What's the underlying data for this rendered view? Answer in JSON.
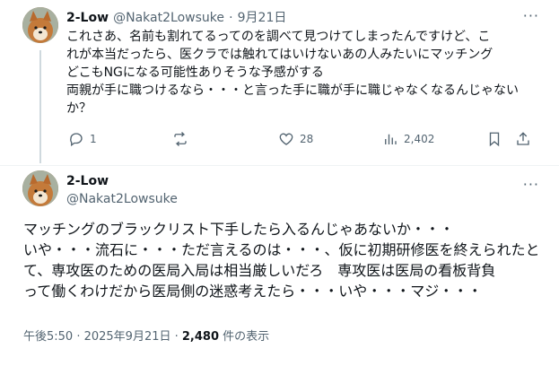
{
  "tweet1": {
    "name": "2-Low",
    "handle": "@Nakat2Lowsuke",
    "sep": "·",
    "date": "9月21日",
    "lines": [
      "これさあ、名前も割れてるってのを調べて見つけてしまったんですけど、こ",
      "れが本当だったら、医クラでは触れてはいけないあの人みたいにマッチング",
      "どこもNGになる可能性ありそうな予感がする",
      "両親が手に職つけるなら・・・と言った手に職が手に職じゃなくなるんじゃない",
      "か？"
    ],
    "actions": {
      "reply": "1",
      "retweet": "",
      "like": "28",
      "views": "2,402"
    },
    "more": "···"
  },
  "tweet2": {
    "name": "2-Low",
    "handle": "@Nakat2Lowsuke",
    "more": "···",
    "lines": [
      "マッチングのブラックリスト下手したら入るんじゃあないか・・・",
      "いや・・・流石に・・・ただ言えるのは・・・、仮に初期研修医を終えられたと",
      "て、専攻医のための医局入局は相当厳しいだろ　専攻医は医局の看板背負",
      "って働くわけだから医局側の迷惑考えたら・・・いや・・・マジ・・・"
    ],
    "footer": {
      "time": "午後5:50 · 2025年9月21日 · ",
      "views_count": "2,480",
      "views_label": " 件の表示"
    }
  },
  "icons": [
    "reply-icon",
    "retweet-icon",
    "like-icon",
    "views-icon",
    "bookmark-icon",
    "share-icon",
    "more-icon"
  ],
  "colors": {
    "text": "#0f1419",
    "muted": "#536471",
    "line": "#cfd9de"
  }
}
